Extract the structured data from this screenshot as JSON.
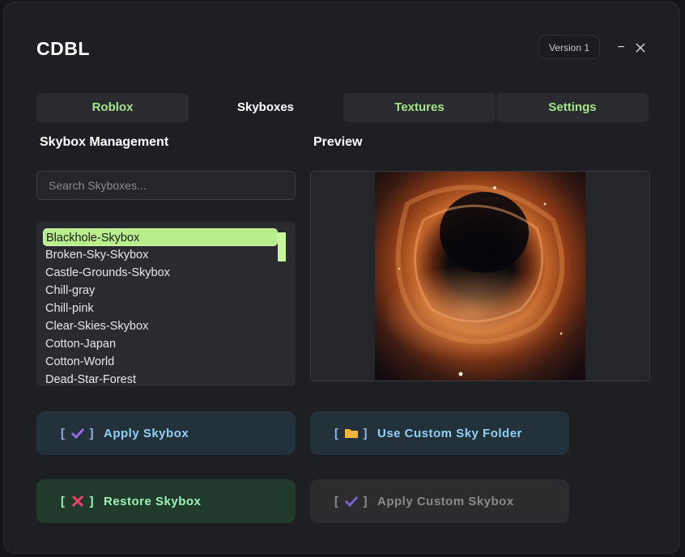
{
  "app": {
    "title": "CDBL",
    "version": "Version 1",
    "minimize_glyph": "−",
    "close_glyph": "✕"
  },
  "tabs": [
    {
      "label": "Roblox",
      "active": false
    },
    {
      "label": "Skyboxes",
      "active": true
    },
    {
      "label": "Textures",
      "active": false
    },
    {
      "label": "Settings",
      "active": false
    }
  ],
  "left": {
    "title": "Skybox Management",
    "search_placeholder": "Search Skyboxes...",
    "items": [
      "Blackhole-Skybox",
      "Broken-Sky-Skybox",
      "Castle-Grounds-Skybox",
      "Chill-gray",
      "Chill-pink",
      "Clear-Skies-Skybox",
      "Cotton-Japan",
      "Cotton-World",
      "Dead-Star-Forest"
    ],
    "selected_index": 0
  },
  "right": {
    "title": "Preview",
    "image": "blackhole-nebula"
  },
  "buttons": {
    "apply": {
      "bracket_open": "[",
      "bracket_close": "]",
      "icon": "check-icon",
      "label": "Apply Skybox"
    },
    "custom_folder": {
      "bracket_open": "[",
      "bracket_close": "]",
      "icon": "folder-icon",
      "label": "Use Custom Sky Folder"
    },
    "restore": {
      "bracket_open": "[",
      "bracket_close": "]",
      "icon": "cross-icon",
      "label": "Restore Skybox"
    },
    "apply_custom": {
      "bracket_open": "[",
      "bracket_close": "]",
      "icon": "check-icon",
      "label": "Apply Custom Skybox",
      "disabled": true
    }
  },
  "colors": {
    "accent": "#a6e388",
    "selected": "#b9ef8a",
    "window_bg": "#1e1f22"
  }
}
